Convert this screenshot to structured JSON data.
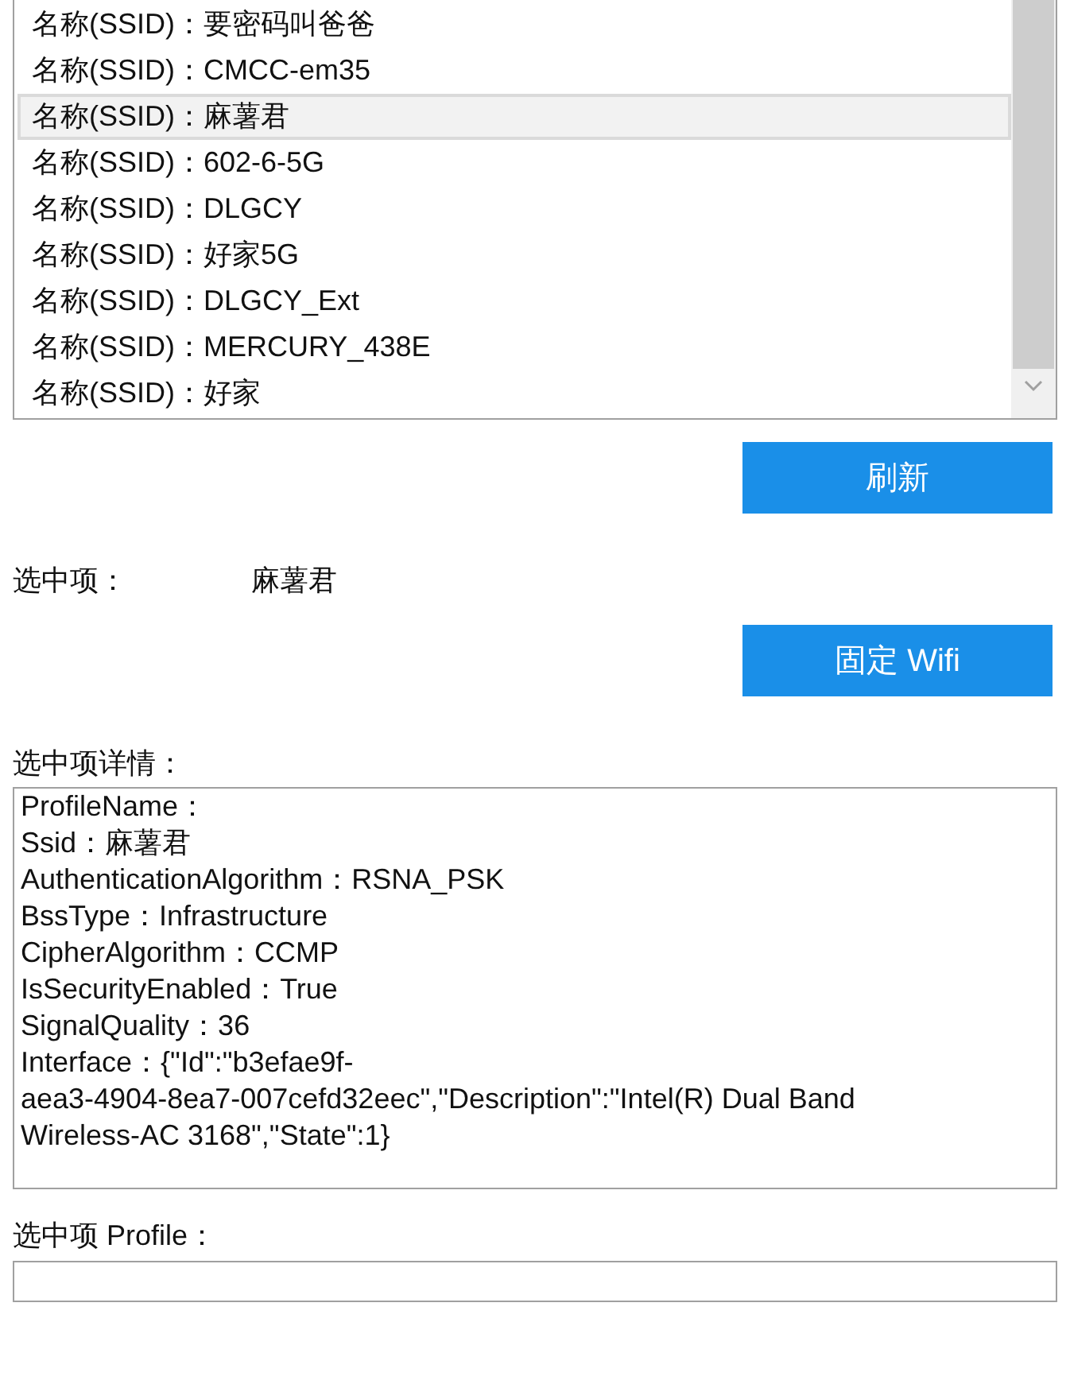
{
  "ssid_list": {
    "items": [
      {
        "label": "名称(SSID)：要密码叫爸爸",
        "selected": false
      },
      {
        "label": "名称(SSID)：CMCC-em35",
        "selected": false
      },
      {
        "label": "名称(SSID)：麻薯君",
        "selected": true
      },
      {
        "label": "名称(SSID)：602-6-5G",
        "selected": false
      },
      {
        "label": "名称(SSID)：DLGCY",
        "selected": false
      },
      {
        "label": "名称(SSID)：好家5G",
        "selected": false
      },
      {
        "label": "名称(SSID)：DLGCY_Ext",
        "selected": false
      },
      {
        "label": "名称(SSID)：MERCURY_438E",
        "selected": false
      },
      {
        "label": "名称(SSID)：好家",
        "selected": false
      }
    ]
  },
  "refresh_button": "刷新",
  "selected_item": {
    "label": "选中项：",
    "value": "麻薯君"
  },
  "pin_button": "固定 Wifi",
  "details": {
    "label": "选中项详情：",
    "lines": [
      "ProfileName：",
      "Ssid：麻薯君",
      "AuthenticationAlgorithm：RSNA_PSK",
      "BssType：Infrastructure",
      "CipherAlgorithm：CCMP",
      "IsSecurityEnabled：True",
      "SignalQuality：36",
      "Interface：{\"Id\":\"b3efae9f-",
      "aea3-4904-8ea7-007cefd32eec\",\"Description\":\"Intel(R) Dual Band",
      "Wireless-AC 3168\",\"State\":1}"
    ]
  },
  "profile": {
    "label": "选中项 Profile："
  }
}
